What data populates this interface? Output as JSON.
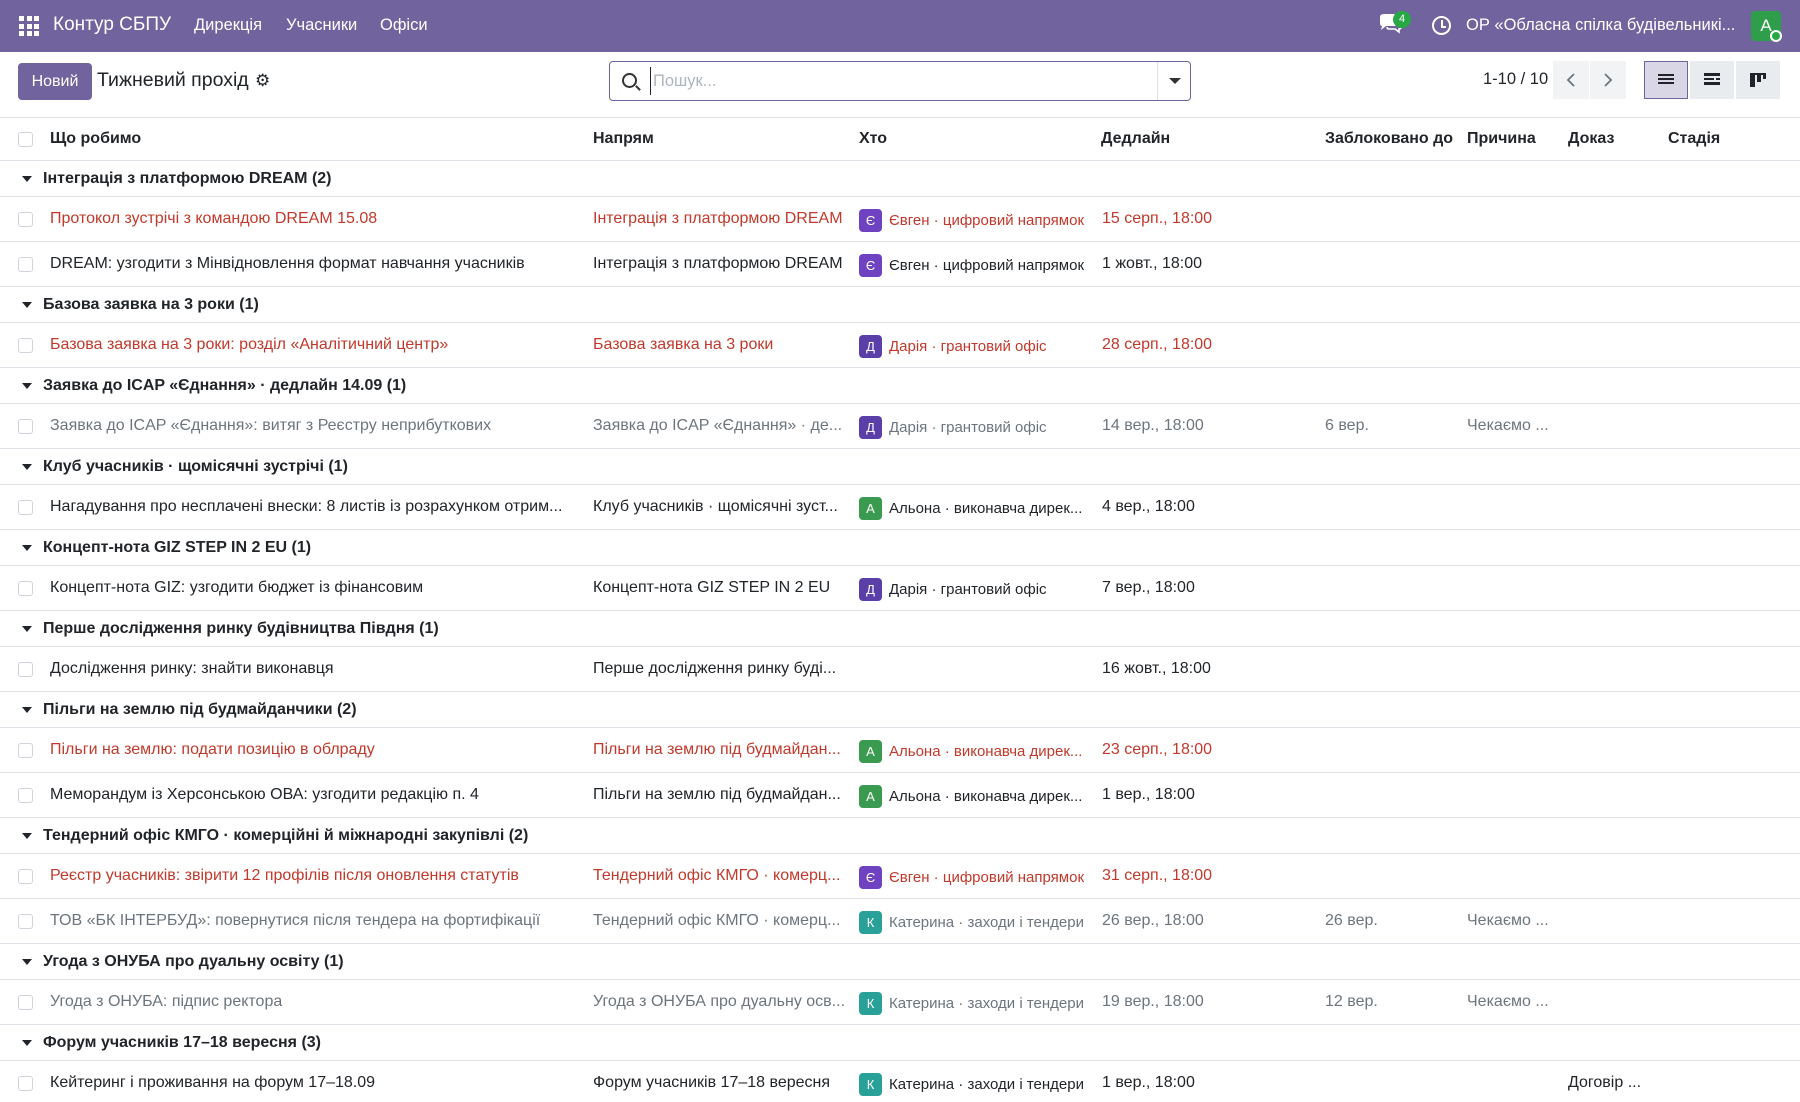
{
  "navbar": {
    "brand": "Контур СБПУ",
    "menu": [
      "Дирекція",
      "Учасники",
      "Офіси"
    ],
    "chat_count": "4",
    "company": "ОР «Обласна спілка будівельникі...",
    "user_initial": "А",
    "colors": {
      "bar": "#71639e",
      "badge": "#28a745"
    }
  },
  "control": {
    "new_label": "Новий",
    "view_title": "Тижневий прохід",
    "search_placeholder": "Пошук...",
    "pager": "1-10 / 10"
  },
  "table": {
    "headers": {
      "task": "Що робимо",
      "direction": "Напрям",
      "who": "Хто",
      "deadline": "Дедлайн",
      "blocked": "Заблоковано до",
      "reason": "Причина",
      "proof": "Доказ",
      "stage": "Стадія"
    },
    "groups": [
      {
        "label": "Інтеграція з платформою DREAM (2)",
        "rows": [
          {
            "task": "Протокол зустрічі з командою DREAM 15.08",
            "direction": "Інтеграція з платформою DREAM",
            "initial": "Є",
            "avatar_color": "#6f42c1",
            "who": "Євген · цифровий напрямок",
            "deadline": "15 серп., 18:00",
            "blocked": "",
            "reason": "",
            "proof": "",
            "state": "overdue"
          },
          {
            "task": "DREAM: узгодити з Мінвідновлення формат навчання учасників",
            "direction": "Інтеграція з платформою DREAM",
            "initial": "Є",
            "avatar_color": "#6f42c1",
            "who": "Євген · цифровий напрямок",
            "deadline": "1 жовт., 18:00",
            "blocked": "",
            "reason": "",
            "proof": "",
            "state": "normal"
          }
        ]
      },
      {
        "label": "Базова заявка на 3 роки (1)",
        "rows": [
          {
            "task": "Базова заявка на 3 роки: розділ «Аналітичний центр»",
            "direction": "Базова заявка на 3 роки",
            "initial": "Д",
            "avatar_color": "#5b3fa8",
            "who": "Дарія · грантовий офіс",
            "deadline": "28 серп., 18:00",
            "blocked": "",
            "reason": "",
            "proof": "",
            "state": "overdue"
          }
        ]
      },
      {
        "label": "Заявка до ICAP «Єднання» · дедлайн 14.09 (1)",
        "rows": [
          {
            "task": "Заявка до ICAP «Єднання»: витяг з Реєстру неприбуткових",
            "direction": "Заявка до ICAP «Єднання» · де...",
            "initial": "Д",
            "avatar_color": "#5b3fa8",
            "who": "Дарія · грантовий офіс",
            "deadline": "14 вер., 18:00",
            "blocked": "6 вер.",
            "reason": "Чекаємо ...",
            "proof": "",
            "state": "muted"
          }
        ]
      },
      {
        "label": "Клуб учасників · щомісячні зустрічі (1)",
        "rows": [
          {
            "task": "Нагадування про несплачені внески: 8 листів із розрахунком отрим...",
            "direction": "Клуб учасників · щомісячні зуст...",
            "initial": "А",
            "avatar_color": "#3a9a50",
            "who": "Альона · виконавча дирек...",
            "deadline": "4 вер., 18:00",
            "blocked": "",
            "reason": "",
            "proof": "",
            "state": "normal"
          }
        ]
      },
      {
        "label": "Концепт-нота GIZ STEP IN 2 EU (1)",
        "rows": [
          {
            "task": "Концепт-нота GIZ: узгодити бюджет із фінансовим",
            "direction": "Концепт-нота GIZ STEP IN 2 EU",
            "initial": "Д",
            "avatar_color": "#5b3fa8",
            "who": "Дарія · грантовий офіс",
            "deadline": "7 вер., 18:00",
            "blocked": "",
            "reason": "",
            "proof": "",
            "state": "normal"
          }
        ]
      },
      {
        "label": "Перше дослідження ринку будівництва Півдня (1)",
        "rows": [
          {
            "task": "Дослідження ринку: знайти виконавця",
            "direction": "Перше дослідження ринку буді...",
            "initial": "",
            "avatar_color": "",
            "who": "",
            "deadline": "16 жовт., 18:00",
            "blocked": "",
            "reason": "",
            "proof": "",
            "state": "normal"
          }
        ]
      },
      {
        "label": "Пільги на землю під будмайданчики (2)",
        "rows": [
          {
            "task": "Пільги на землю: подати позицію в облраду",
            "direction": "Пільги на землю під будмайдан...",
            "initial": "А",
            "avatar_color": "#3a9a50",
            "who": "Альона · виконавча дирек...",
            "deadline": "23 серп., 18:00",
            "blocked": "",
            "reason": "",
            "proof": "",
            "state": "overdue"
          },
          {
            "task": "Меморандум із Херсонською ОВА: узгодити редакцію п. 4",
            "direction": "Пільги на землю під будмайдан...",
            "initial": "А",
            "avatar_color": "#3a9a50",
            "who": "Альона · виконавча дирек...",
            "deadline": "1 вер., 18:00",
            "blocked": "",
            "reason": "",
            "proof": "",
            "state": "normal"
          }
        ]
      },
      {
        "label": "Тендерний офіс КМГО · комерційні й міжнародні закупівлі (2)",
        "rows": [
          {
            "task": "Реєстр учасників: звірити 12 профілів після оновлення статутів",
            "direction": "Тендерний офіс КМГО · комерц...",
            "initial": "Є",
            "avatar_color": "#6f42c1",
            "who": "Євген · цифровий напрямок",
            "deadline": "31 серп., 18:00",
            "blocked": "",
            "reason": "",
            "proof": "",
            "state": "overdue"
          },
          {
            "task": "ТОВ «БК ІНТЕРБУД»: повернутися після тендера на фортифікації",
            "direction": "Тендерний офіс КМГО · комерц...",
            "initial": "К",
            "avatar_color": "#2aa198",
            "who": "Катерина · заходи і тендери",
            "deadline": "26 вер., 18:00",
            "blocked": "26 вер.",
            "reason": "Чекаємо ...",
            "proof": "",
            "state": "muted"
          }
        ]
      },
      {
        "label": "Угода з ОНУБА про дуальну освіту (1)",
        "rows": [
          {
            "task": "Угода з ОНУБА: підпис ректора",
            "direction": "Угода з ОНУБА про дуальну осв...",
            "initial": "К",
            "avatar_color": "#2aa198",
            "who": "Катерина · заходи і тендери",
            "deadline": "19 вер., 18:00",
            "blocked": "12 вер.",
            "reason": "Чекаємо ...",
            "proof": "",
            "state": "muted"
          }
        ]
      },
      {
        "label": "Форум учасників 17–18 вересня (3)",
        "rows": [
          {
            "task": "Кейтеринг і проживання на форум 17–18.09",
            "direction": "Форум учасників 17–18 вересня",
            "initial": "К",
            "avatar_color": "#2aa198",
            "who": "Катерина · заходи і тендери",
            "deadline": "1 вер., 18:00",
            "blocked": "",
            "reason": "",
            "proof": "Договір ...",
            "state": "normal"
          }
        ]
      }
    ]
  }
}
